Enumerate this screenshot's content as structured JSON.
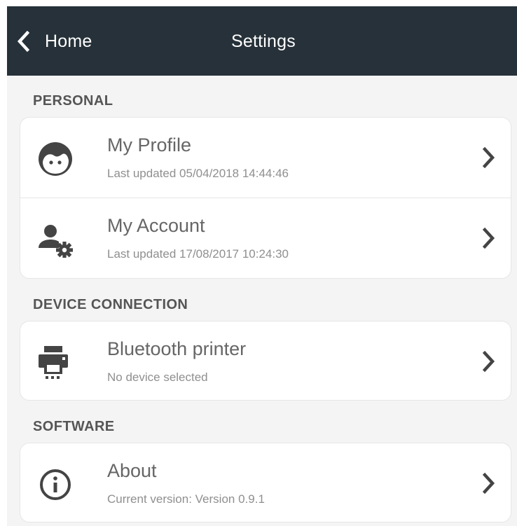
{
  "header": {
    "back_label": "Home",
    "title": "Settings"
  },
  "sections": [
    {
      "header": "PERSONAL",
      "items": [
        {
          "title": "My Profile",
          "subtitle": "Last updated 05/04/2018 14:44:46",
          "icon": "profile-face-icon"
        },
        {
          "title": "My Account",
          "subtitle": "Last updated 17/08/2017 10:24:30",
          "icon": "account-settings-icon"
        }
      ]
    },
    {
      "header": "DEVICE CONNECTION",
      "items": [
        {
          "title": "Bluetooth printer",
          "subtitle": "No device selected",
          "icon": "printer-icon"
        }
      ]
    },
    {
      "header": "SOFTWARE",
      "items": [
        {
          "title": "About",
          "subtitle": "Current version: Version 0.9.1",
          "icon": "info-icon"
        }
      ]
    }
  ],
  "colors": {
    "topbar": "#263139",
    "background": "#f4f4f4",
    "card": "#ffffff",
    "icon": "#444444",
    "title_text": "#666666",
    "subtitle_text": "#8f8f8f",
    "section_text": "#555555"
  }
}
